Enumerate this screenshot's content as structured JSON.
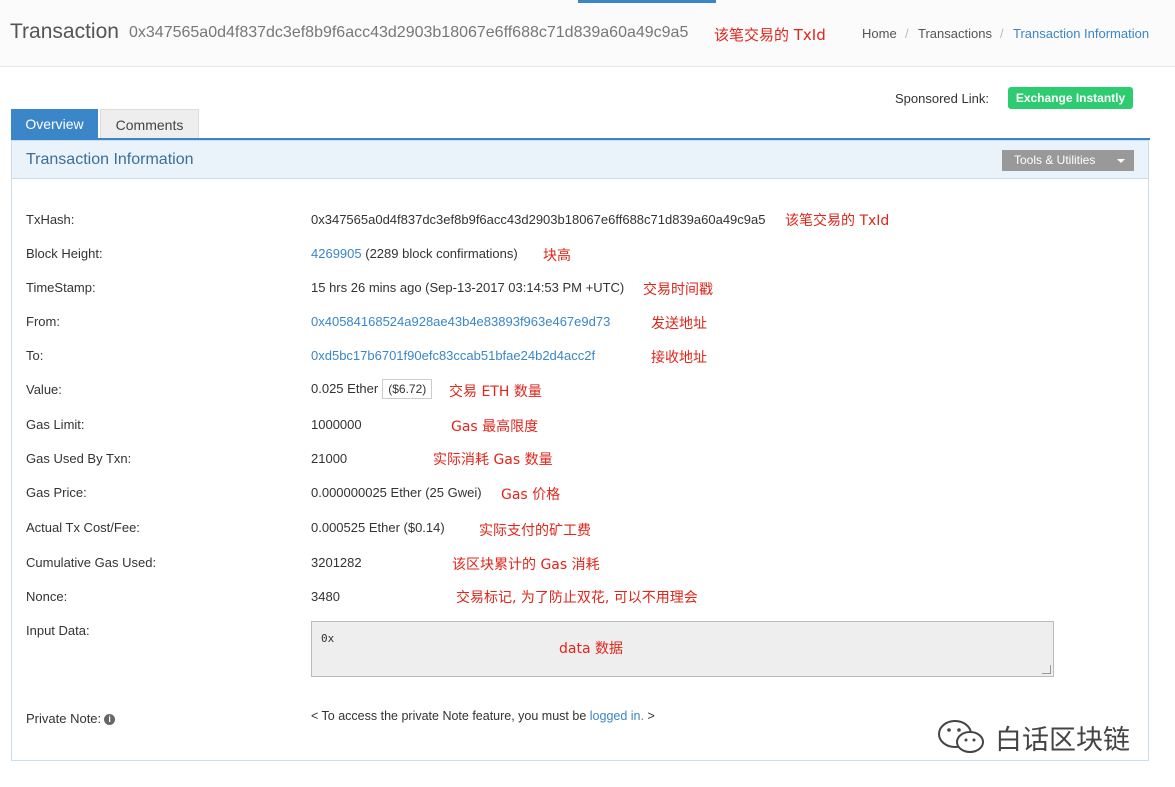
{
  "header": {
    "title": "Transaction",
    "hash": "0x347565a0d4f837dc3ef8b9f6acc43d2903b18067e6ff688c71d839a60a49c9a5",
    "annotation": "该笔交易的 TxId",
    "breadcrumb": {
      "home": "Home",
      "transactions": "Transactions",
      "current": "Transaction Information",
      "separator": "/"
    }
  },
  "sponsor": {
    "label": "Sponsored Link:",
    "button": "Exchange Instantly"
  },
  "tabs": {
    "overview": "Overview",
    "comments": "Comments"
  },
  "panel": {
    "title": "Transaction Information",
    "tools": "Tools & Utilities"
  },
  "rows": {
    "txhash": {
      "label": "TxHash:",
      "value": "0x347565a0d4f837dc3ef8b9f6acc43d2903b18067e6ff688c71d839a60a49c9a5",
      "annotation": "该笔交易的 TxId"
    },
    "block": {
      "label": "Block Height:",
      "link": "4269905",
      "extra": "(2289 block confirmations)",
      "annotation": "块高"
    },
    "timestamp": {
      "label": "TimeStamp:",
      "value": "15 hrs 26 mins ago (Sep-13-2017 03:14:53 PM +UTC)",
      "annotation": "交易时间戳"
    },
    "from": {
      "label": "From:",
      "link": "0x40584168524a928ae43b4e83893f963e467e9d73",
      "annotation": "发送地址"
    },
    "to": {
      "label": "To:",
      "link": "0xd5bc17b6701f90efc83ccab51bfae24b2d4acc2f",
      "annotation": "接收地址"
    },
    "value": {
      "label": "Value:",
      "value": "0.025 Ether",
      "usd": "($6.72)",
      "annotation": "交易 ETH 数量"
    },
    "gas_limit": {
      "label": "Gas Limit:",
      "value": "1000000",
      "annotation": "Gas 最高限度"
    },
    "gas_used": {
      "label": "Gas Used By Txn:",
      "value": "21000",
      "annotation": "实际消耗 Gas 数量"
    },
    "gas_price": {
      "label": "Gas Price:",
      "value": "0.000000025 Ether (25 Gwei)",
      "annotation": "Gas 价格"
    },
    "fee": {
      "label": "Actual Tx Cost/Fee:",
      "value": "0.000525 Ether ($0.14)",
      "annotation": "实际支付的矿工费"
    },
    "cumulative": {
      "label": "Cumulative Gas Used:",
      "value": "3201282",
      "annotation": "该区块累计的 Gas 消耗"
    },
    "nonce": {
      "label": "Nonce:",
      "value": "3480",
      "annotation": "交易标记, 为了防止双花, 可以不用理会"
    },
    "input": {
      "label": "Input Data:",
      "value": "0x",
      "annotation": "data 数据"
    },
    "private_note": {
      "label": "Private Note:",
      "prefix": "< To access the private Note feature, you must be",
      "link": "logged in.",
      "suffix": ">"
    }
  },
  "watermark": "白话区块链",
  "colors": {
    "accent": "#3a86c8",
    "annotation": "#e0251b",
    "button_green": "#2ecc71"
  }
}
